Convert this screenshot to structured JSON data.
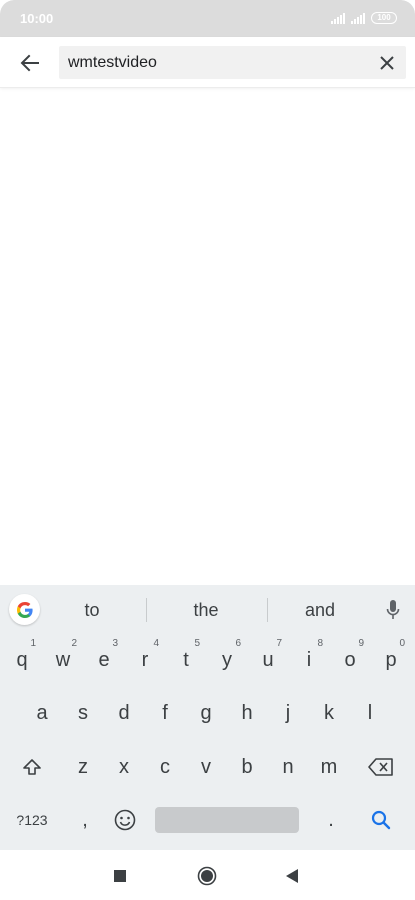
{
  "status_bar": {
    "time": "10:00",
    "battery": "100",
    "icons": [
      "signal-icon",
      "signal-icon",
      "battery-icon"
    ]
  },
  "search": {
    "value": "wmtestvideo",
    "back_icon": "arrow-left-icon",
    "clear_icon": "close-icon"
  },
  "keyboard": {
    "logo_icon": "google-g-icon",
    "suggestions": [
      "to",
      "the",
      "and"
    ],
    "mic_icon": "microphone-icon",
    "row1": [
      {
        "key": "q",
        "hint": "1"
      },
      {
        "key": "w",
        "hint": "2"
      },
      {
        "key": "e",
        "hint": "3"
      },
      {
        "key": "r",
        "hint": "4"
      },
      {
        "key": "t",
        "hint": "5"
      },
      {
        "key": "y",
        "hint": "6"
      },
      {
        "key": "u",
        "hint": "7"
      },
      {
        "key": "i",
        "hint": "8"
      },
      {
        "key": "o",
        "hint": "9"
      },
      {
        "key": "p",
        "hint": "0"
      }
    ],
    "row2": [
      "a",
      "s",
      "d",
      "f",
      "g",
      "h",
      "j",
      "k",
      "l"
    ],
    "row3": [
      "z",
      "x",
      "c",
      "v",
      "b",
      "n",
      "m"
    ],
    "shift_icon": "shift-arrow-icon",
    "backspace_icon": "backspace-icon",
    "symbols_label": "?123",
    "comma_label": ",",
    "emoji_icon": "emoji-icon",
    "period_label": ".",
    "search_icon": "search-icon",
    "accent_color": "#1a73e8"
  },
  "nav_bar": {
    "icons": [
      "recent-apps-square-icon",
      "home-circle-icon",
      "back-triangle-icon"
    ]
  }
}
